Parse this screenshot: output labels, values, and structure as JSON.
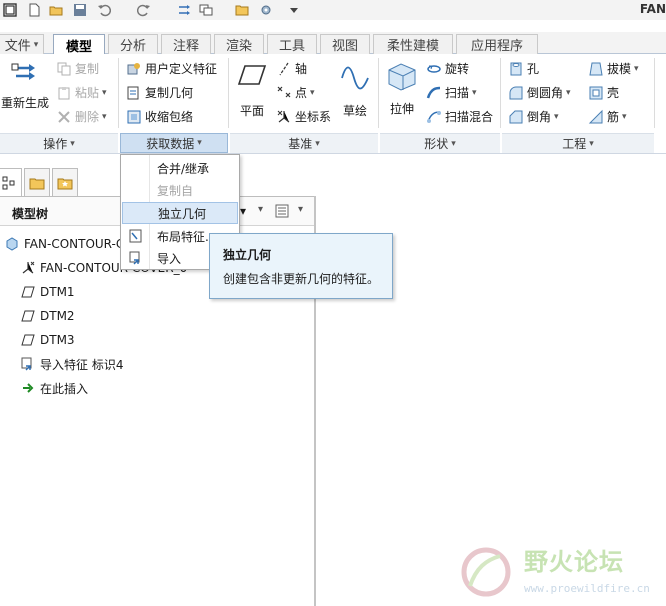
{
  "window": {
    "title": "FAN"
  },
  "quick_access": {
    "icons": [
      "window-icon",
      "new-file-icon",
      "open-folder-icon",
      "save-icon",
      "undo-icon",
      "redo-icon",
      "regenerate-icon",
      "windows-icon",
      "folder-icon",
      "settings-icon",
      "customize-icon"
    ]
  },
  "tabs": [
    {
      "label": "文件",
      "active": false,
      "has_menu": true
    },
    {
      "label": "模型",
      "active": true
    },
    {
      "label": "分析",
      "active": false
    },
    {
      "label": "注释",
      "active": false
    },
    {
      "label": "渲染",
      "active": false
    },
    {
      "label": "工具",
      "active": false
    },
    {
      "label": "视图",
      "active": false
    },
    {
      "label": "柔性建模",
      "active": false
    },
    {
      "label": "应用程序",
      "active": false
    }
  ],
  "ribbon": {
    "operations": {
      "regenerate": "重新生成",
      "copy": "复制",
      "paste": "粘贴",
      "delete": "删除"
    },
    "get_data": {
      "user_defined_feature": "用户定义特征",
      "copy_geometry": "复制几何",
      "shrinkwrap": "收缩包络"
    },
    "datum": {
      "plane": "平面",
      "axis": "轴",
      "point": "点",
      "coordinate_system": "坐标系",
      "sketch": "草绘"
    },
    "shapes": {
      "extrude": "拉伸",
      "revolve": "旋转",
      "sweep": "扫描",
      "swept_blend": "扫描混合"
    },
    "engineering": {
      "hole": "孔",
      "round": "倒圆角",
      "chamfer": "倒角",
      "draft": "拔模",
      "shell": "壳",
      "rib": "筋"
    },
    "groups": [
      {
        "label": "操作",
        "active": false
      },
      {
        "label": "获取数据",
        "active": true
      },
      {
        "label": "基准",
        "active": false
      },
      {
        "label": "形状",
        "active": false
      },
      {
        "label": "工程",
        "active": false
      }
    ]
  },
  "dropdown": {
    "items": [
      {
        "label": "合并/继承",
        "disabled": false
      },
      {
        "label": "复制自",
        "disabled": true
      },
      {
        "label": "独立几何",
        "disabled": false,
        "highlighted": true
      },
      {
        "label": "布局特征...",
        "disabled": false
      },
      {
        "label": "导入",
        "disabled": false
      }
    ]
  },
  "tooltip": {
    "title": "独立几何",
    "description": "创建包含非更新几何的特征。"
  },
  "model_tree": {
    "title": "模型树",
    "items": [
      {
        "label": "FAN-CONTOUR-C",
        "icon": "part-icon"
      },
      {
        "label": "FAN-CONTOUR-COVER_0",
        "icon": "csys-icon"
      },
      {
        "label": "DTM1",
        "icon": "datum-plane-icon"
      },
      {
        "label": "DTM2",
        "icon": "datum-plane-icon"
      },
      {
        "label": "DTM3",
        "icon": "datum-plane-icon"
      },
      {
        "label": "导入特征 标识4",
        "icon": "import-feature-icon"
      },
      {
        "label": "在此插入",
        "icon": "insert-arrow-icon"
      }
    ]
  },
  "watermark": {
    "text": "野火论坛",
    "url": "www.proewildfire.cn"
  },
  "colors": {
    "accent_blue": "#3a8fd6",
    "hover_bg": "#dbe9f8",
    "tooltip_bg": "#eaf4fb",
    "insert_arrow": "#1f8a24"
  }
}
